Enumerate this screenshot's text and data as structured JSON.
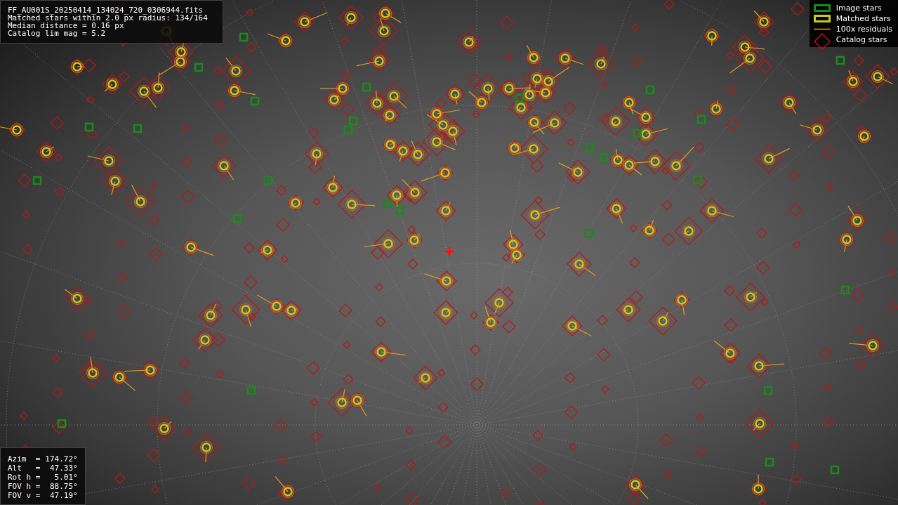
{
  "image_info": {
    "lines": [
      "FF_AU001S_20250414_134024_720_0306944.fits",
      "Matched stars within 2.0 px radius: 134/164",
      "Median distance = 0.16 px",
      "Catalog lim mag = 5.2"
    ]
  },
  "legend": [
    {
      "kind": "box",
      "color": "#1a8a1a",
      "label": "Image stars"
    },
    {
      "kind": "box",
      "color": "#c8c81e",
      "label": "Matched stars"
    },
    {
      "kind": "line",
      "color": "#e89a1a",
      "label": "100x residuals"
    },
    {
      "kind": "diamond",
      "color": "#c01010",
      "label": "Catalog stars"
    }
  ],
  "pointing": {
    "rows": [
      {
        "label": "Azim  =",
        "value": "174.72°"
      },
      {
        "label": "Alt   =",
        "value": " 47.33°"
      },
      {
        "label": "Rot h =",
        "value": "  5.01°"
      },
      {
        "label": "FOV h =",
        "value": " 88.75°"
      },
      {
        "label": "FOV v =",
        "value": " 47.19°"
      }
    ]
  }
}
